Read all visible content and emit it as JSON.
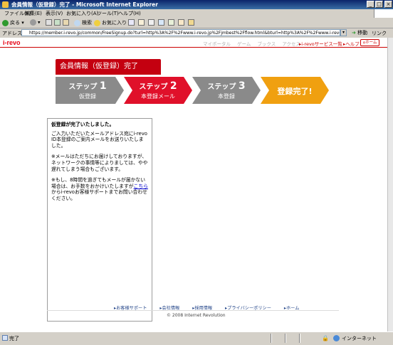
{
  "window": {
    "title": "会員情報（仮登録）完了 - Microsoft Internet Explorer"
  },
  "menu": [
    "ファイル(F)",
    "編集(E)",
    "表示(V)",
    "お気に入り(A)",
    "ツール(T)",
    "ヘルプ(H)"
  ],
  "toolbar": {
    "back": "戻る",
    "search": "検索",
    "favorites": "お気に入り"
  },
  "address": {
    "label": "アドレス(D)",
    "url": "https://member.i-revo.jp/common/FreeSignup.do?turl=http%3A%2F%2Fwww.i-revo.jp%2Fjmbest%2Fflow.html&bturl=http%3A%2F%2Fwww.i-revo.jp%2Fjmbest%2Fflow.htm",
    "go": "移動",
    "links": "リンク"
  },
  "site": {
    "logo": "i-revo",
    "nav": [
      "マイポータル",
      "ゲーム",
      "ブックス",
      "アクセス"
    ],
    "service_list": "i-revoサービス一覧",
    "help": "ヘルプ",
    "home": "ホーム"
  },
  "page_title": "会員情報（仮登録）完了",
  "steps": [
    {
      "label": "ステップ",
      "num": "1",
      "sub": "仮登録"
    },
    {
      "label": "ステップ",
      "num": "2",
      "sub": "本登録メール"
    },
    {
      "label": "ステップ",
      "num": "3",
      "sub": "本登録"
    },
    {
      "label": "登録完了!",
      "num": "",
      "sub": ""
    }
  ],
  "message": {
    "heading": "仮登録が完了いたしました。",
    "p1": "ご入力いただいたメールアドレス宛にi-revo ID本登録のご案内メールをお送りいたしました。",
    "p2": "※メールはただちにお届けしておりますが、ネットワークの事情等によりましては、やや遅れてしまう場合もございます。",
    "p3_before": "※もし、8時間を過ぎてもメールが届かない場合は、お手数をおかけいたしますが",
    "p3_link": "こちら",
    "p3_after": "からi-revoお客様サポートまでお問い合わせください。"
  },
  "footer": {
    "links": [
      "お客様サポート",
      "会社情報",
      "採用情報",
      "プライバシーポリシー",
      "ホーム"
    ],
    "copyright": "© 2008 Internet Revolution"
  },
  "status": {
    "text": "完了",
    "zone": "インターネット"
  },
  "colors": {
    "brand_red": "#c40010",
    "step_gray": "#8a8a8a",
    "step_active": "#e0102a",
    "step_done": "#f0a010"
  }
}
